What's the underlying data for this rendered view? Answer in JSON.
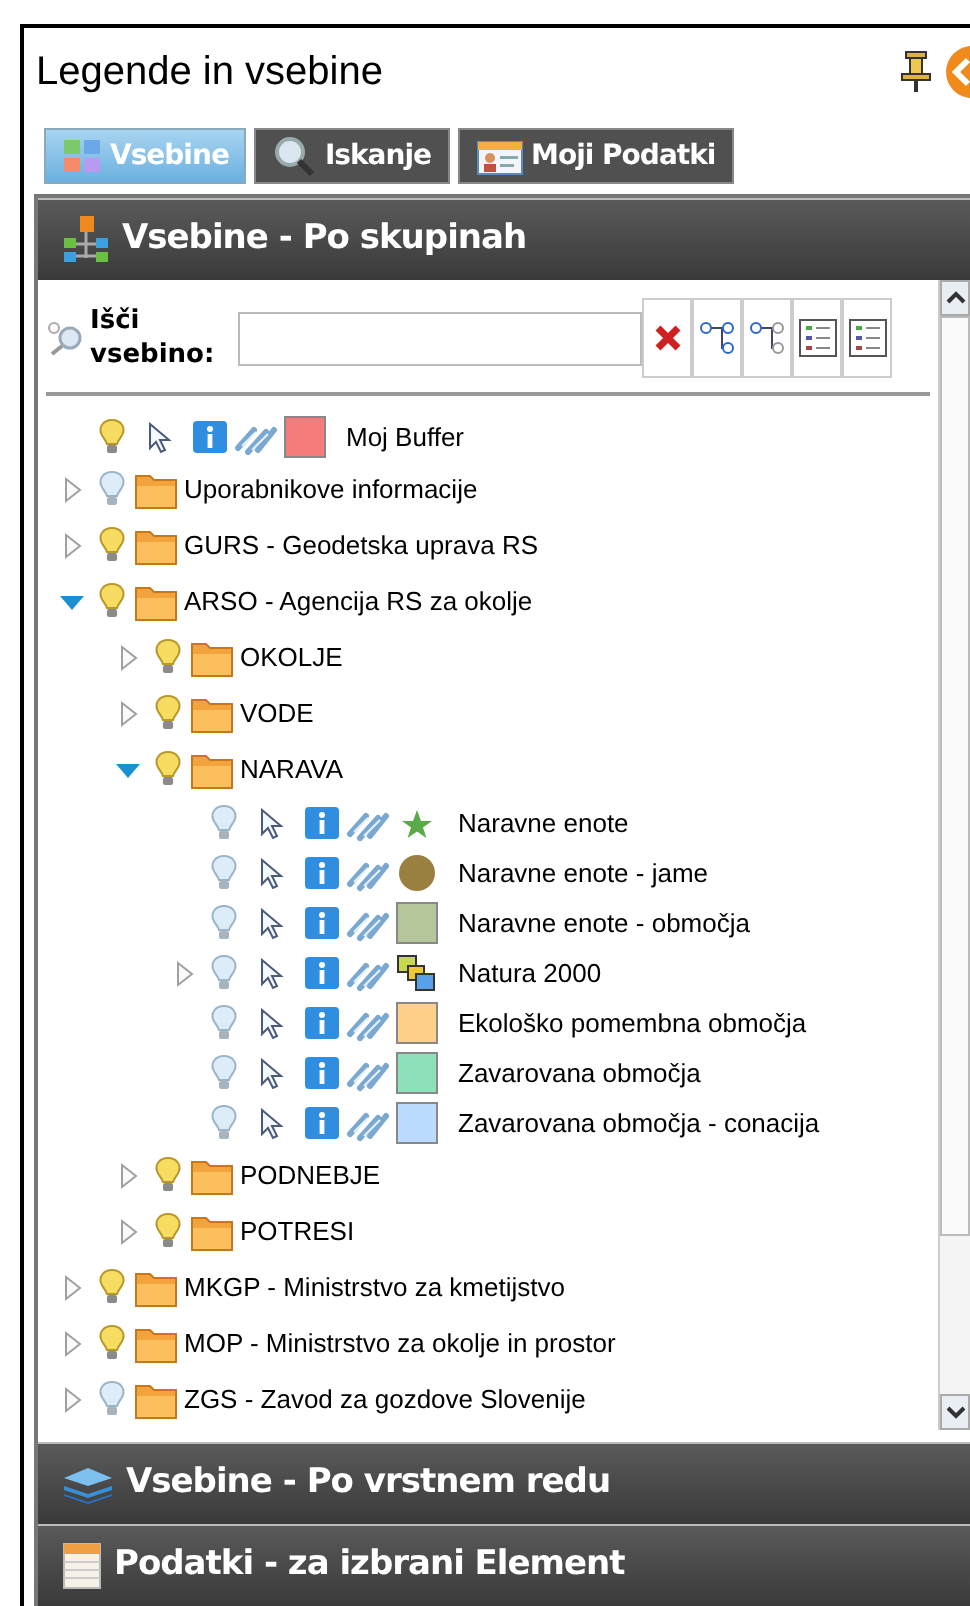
{
  "window": {
    "title": "Legende in vsebine"
  },
  "tabs": [
    {
      "label": "Vsebine",
      "selected": true
    },
    {
      "label": "Iskanje",
      "selected": false
    },
    {
      "label": "Moji Podatki",
      "selected": false
    }
  ],
  "sections": [
    {
      "title": "Vsebine - Po skupinah",
      "expanded": true
    },
    {
      "title": "Vsebine - Po vrstnem redu",
      "expanded": false
    },
    {
      "title": "Podatki - za izbrani Element",
      "expanded": false
    }
  ],
  "search": {
    "label": "Išči vsebino:"
  },
  "tree": [
    {
      "kind": "layer",
      "label": "Moj Buffer",
      "light_on": true,
      "symbol": {
        "kind": "swatch",
        "color": "#f47c7c"
      }
    },
    {
      "kind": "folder",
      "label": "Uporabnikove informacije",
      "light_on": false,
      "expanded": false
    },
    {
      "kind": "folder",
      "label": "GURS - Geodetska uprava RS",
      "light_on": true,
      "expanded": false
    },
    {
      "kind": "folder",
      "label": "ARSO - Agencija RS za okolje",
      "light_on": true,
      "expanded": true,
      "children": [
        {
          "kind": "folder",
          "label": "OKOLJE",
          "light_on": true,
          "expanded": false
        },
        {
          "kind": "folder",
          "label": "VODE",
          "light_on": true,
          "expanded": false
        },
        {
          "kind": "folder",
          "label": "NARAVA",
          "light_on": true,
          "expanded": true,
          "children": [
            {
              "kind": "layer",
              "label": "Naravne enote",
              "light_on": false,
              "symbol": {
                "kind": "star",
                "color": "#5aaa48"
              }
            },
            {
              "kind": "layer",
              "label": "Naravne enote - jame",
              "light_on": false,
              "symbol": {
                "kind": "circle",
                "color": "#9a8040"
              }
            },
            {
              "kind": "layer",
              "label": "Naravne enote - območja",
              "light_on": false,
              "symbol": {
                "kind": "swatch",
                "color": "#b4c69a"
              }
            },
            {
              "kind": "layer",
              "label": "Natura 2000",
              "light_on": false,
              "symbol": {
                "kind": "group"
              },
              "expanded": false
            },
            {
              "kind": "layer",
              "label": "Ekološko pomembna območja",
              "light_on": false,
              "symbol": {
                "kind": "swatch",
                "color": "#ffd08c"
              }
            },
            {
              "kind": "layer",
              "label": "Zavarovana območja",
              "light_on": false,
              "symbol": {
                "kind": "swatch",
                "color": "#8ee2ba"
              }
            },
            {
              "kind": "layer",
              "label": "Zavarovana območja - conacija",
              "light_on": false,
              "symbol": {
                "kind": "swatch",
                "color": "#bcdcff"
              }
            }
          ]
        },
        {
          "kind": "folder",
          "label": "PODNEBJE",
          "light_on": true,
          "expanded": false
        },
        {
          "kind": "folder",
          "label": "POTRESI",
          "light_on": true,
          "expanded": false
        }
      ]
    },
    {
      "kind": "folder",
      "label": "MKGP - Ministrstvo za kmetijstvo",
      "light_on": true,
      "expanded": false
    },
    {
      "kind": "folder",
      "label": "MOP - Ministrstvo za okolje in prostor",
      "light_on": true,
      "expanded": false
    },
    {
      "kind": "folder",
      "label": "ZGS - Zavod za gozdove Slovenije",
      "light_on": false,
      "expanded": false
    }
  ]
}
